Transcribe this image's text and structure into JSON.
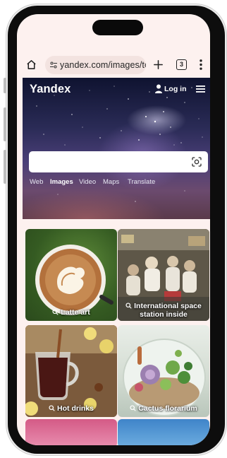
{
  "browser": {
    "url": "yandex.com/images/tc",
    "tab_count": "3"
  },
  "header": {
    "logo": "Yandex",
    "login_label": "Log in"
  },
  "search": {
    "value": "",
    "placeholder": ""
  },
  "services": [
    {
      "label": "Web",
      "active": false
    },
    {
      "label": "Images",
      "active": true
    },
    {
      "label": "Video",
      "active": false
    },
    {
      "label": "Maps",
      "active": false
    },
    {
      "label": "Translate",
      "active": false
    }
  ],
  "gallery": [
    {
      "caption_line1": "Latte art",
      "caption_line2": ""
    },
    {
      "caption_line1": "International space",
      "caption_line2": "station inside"
    },
    {
      "caption_line1": "Hot drinks",
      "caption_line2": ""
    },
    {
      "caption_line1": "Cactus florarium",
      "caption_line2": ""
    }
  ],
  "colors": {
    "screen_bg": "#fdf1ef",
    "url_pill": "#f3e3e0",
    "hero_sky": "#2a2b56"
  },
  "icons": [
    "home-icon",
    "site-settings-icon",
    "plus-icon",
    "tabs-icon",
    "more-vert-icon",
    "user-icon",
    "menu-icon",
    "camera-search-icon",
    "search-icon"
  ]
}
